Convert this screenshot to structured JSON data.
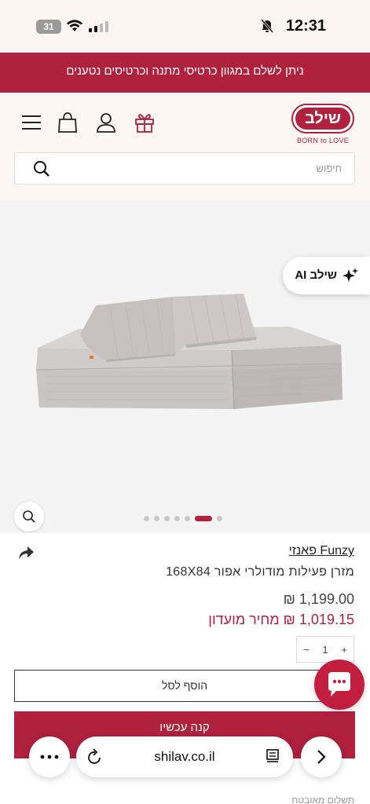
{
  "status_bar": {
    "time": "12:31",
    "battery": "31",
    "icons": [
      "battery-icon",
      "wifi-icon",
      "signal-icon",
      "bell-muted-icon"
    ]
  },
  "promo": {
    "text": "ניתן לשלם במגוון כרטיסי מתנה וכרטיסים נטענים"
  },
  "header": {
    "logo_text": "שילב",
    "logo_tagline": "BORN to LOVE",
    "icons": [
      "gift-icon",
      "user-icon",
      "bag-icon",
      "menu-icon"
    ],
    "search_placeholder": "חיפוש"
  },
  "gallery": {
    "ai_button": "שילב AI",
    "slide_count": 7,
    "active_slide": 6
  },
  "product": {
    "brand": "Funzy פאנזי",
    "title": "מזרן פעילות מודולרי אפור 168X84",
    "price_original": "1,199.00 ₪",
    "price_club": "1,019.15 ₪ מחיר מועדון",
    "quantity": "1",
    "qty_minus": "−",
    "qty_plus": "+",
    "add_to_cart": "הוסף לסל",
    "buy_now": "קנה עכשיו"
  },
  "browser": {
    "url": "shilav.co.il"
  },
  "bottom_partial": "תשלום מאובטח",
  "colors": {
    "brand": "#b0213e",
    "background": "#fbf5f1",
    "gallery_bg": "#f4f4f4"
  }
}
